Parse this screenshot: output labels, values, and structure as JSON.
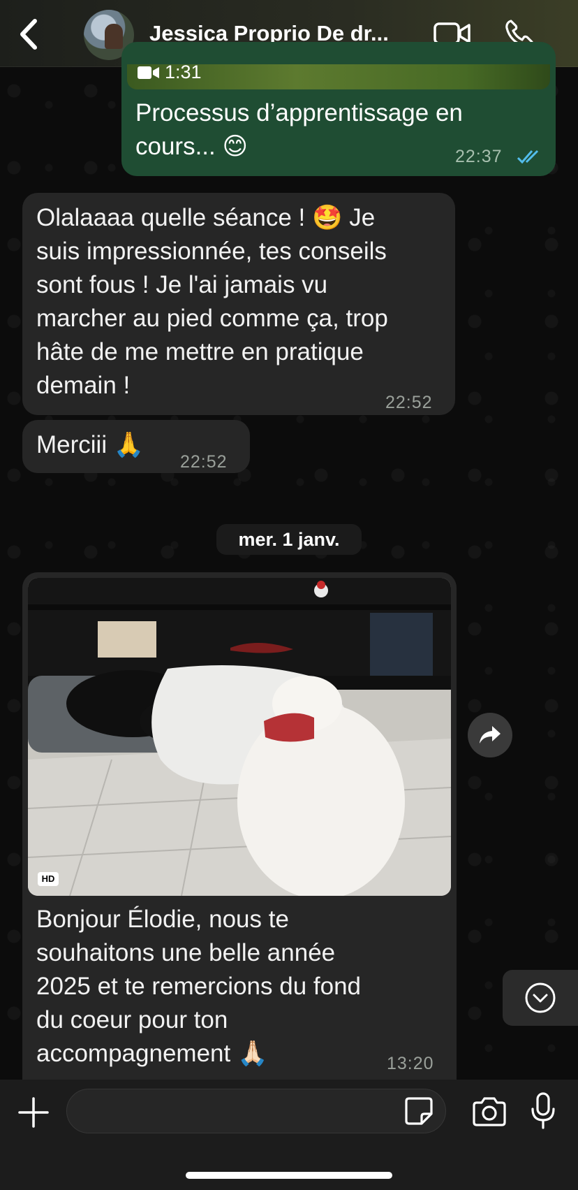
{
  "header": {
    "contact_name": "Jessica Proprio De dr...",
    "back_icon": "chevron-left-icon",
    "video_icon": "video-camera-icon",
    "call_icon": "phone-icon"
  },
  "messages": [
    {
      "direction": "outgoing",
      "media_duration": "1:31",
      "text_line1": "Processus d’apprentissage en",
      "text_line2": "cours... 😊",
      "time": "22:37",
      "status": "read"
    },
    {
      "direction": "incoming",
      "lines": [
        "Olalaaaa quelle séance ! 🤩 Je",
        "suis impressionnée, tes conseils",
        "sont fous ! Je l'ai jamais vu",
        "marcher au pied comme ça, trop",
        "hâte de me mettre en pratique",
        "demain !"
      ],
      "time": "22:52"
    },
    {
      "direction": "incoming",
      "text": "Merciii 🙏",
      "time": "22:52"
    },
    {
      "direction": "incoming",
      "has_photo": true,
      "photo_badge": "HD",
      "lines": [
        "Bonjour Élodie, nous te",
        "souhaitons une belle année",
        "2025 et te remercions du fond",
        "du coeur pour ton",
        "accompagnement 🙏🏻"
      ],
      "time": "13:20"
    }
  ],
  "date_separator": "mer. 1 janv.",
  "input": {
    "placeholder": "",
    "value": ""
  },
  "colors": {
    "outgoing_bubble": "#1f4d33",
    "incoming_bubble": "#262626",
    "read_ticks": "#53bdeb"
  }
}
